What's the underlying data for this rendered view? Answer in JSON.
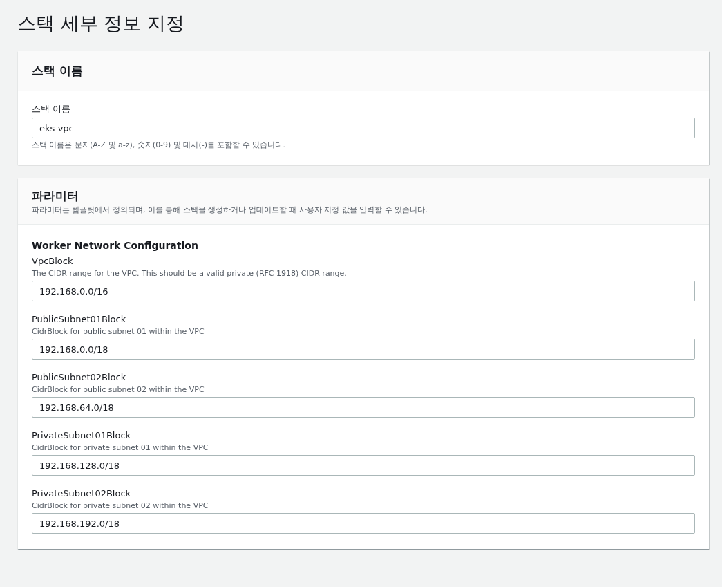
{
  "page_title": "스택 세부 정보 지정",
  "stack_name": {
    "title": "스택 이름",
    "label": "스택 이름",
    "value": "eks-vpc",
    "hint": "스택 이름은 문자(A-Z 및 a-z), 숫자(0-9) 및 대시(-)를 포함할 수 있습니다."
  },
  "parameters": {
    "title": "파라미터",
    "description": "파라미터는 템플릿에서 정의되며, 이를 통해 스택을 생성하거나 업데이트할 때 사용자 지정 값을 입력할 수 있습니다.",
    "group_title": "Worker Network Configuration",
    "fields": [
      {
        "label": "VpcBlock",
        "description": "The CIDR range for the VPC. This should be a valid private (RFC 1918) CIDR range.",
        "value": "192.168.0.0/16"
      },
      {
        "label": "PublicSubnet01Block",
        "description": "CidrBlock for public subnet 01 within the VPC",
        "value": "192.168.0.0/18"
      },
      {
        "label": "PublicSubnet02Block",
        "description": "CidrBlock for public subnet 02 within the VPC",
        "value": "192.168.64.0/18"
      },
      {
        "label": "PrivateSubnet01Block",
        "description": "CidrBlock for private subnet 01 within the VPC",
        "value": "192.168.128.0/18"
      },
      {
        "label": "PrivateSubnet02Block",
        "description": "CidrBlock for private subnet 02 within the VPC",
        "value": "192.168.192.0/18"
      }
    ]
  }
}
